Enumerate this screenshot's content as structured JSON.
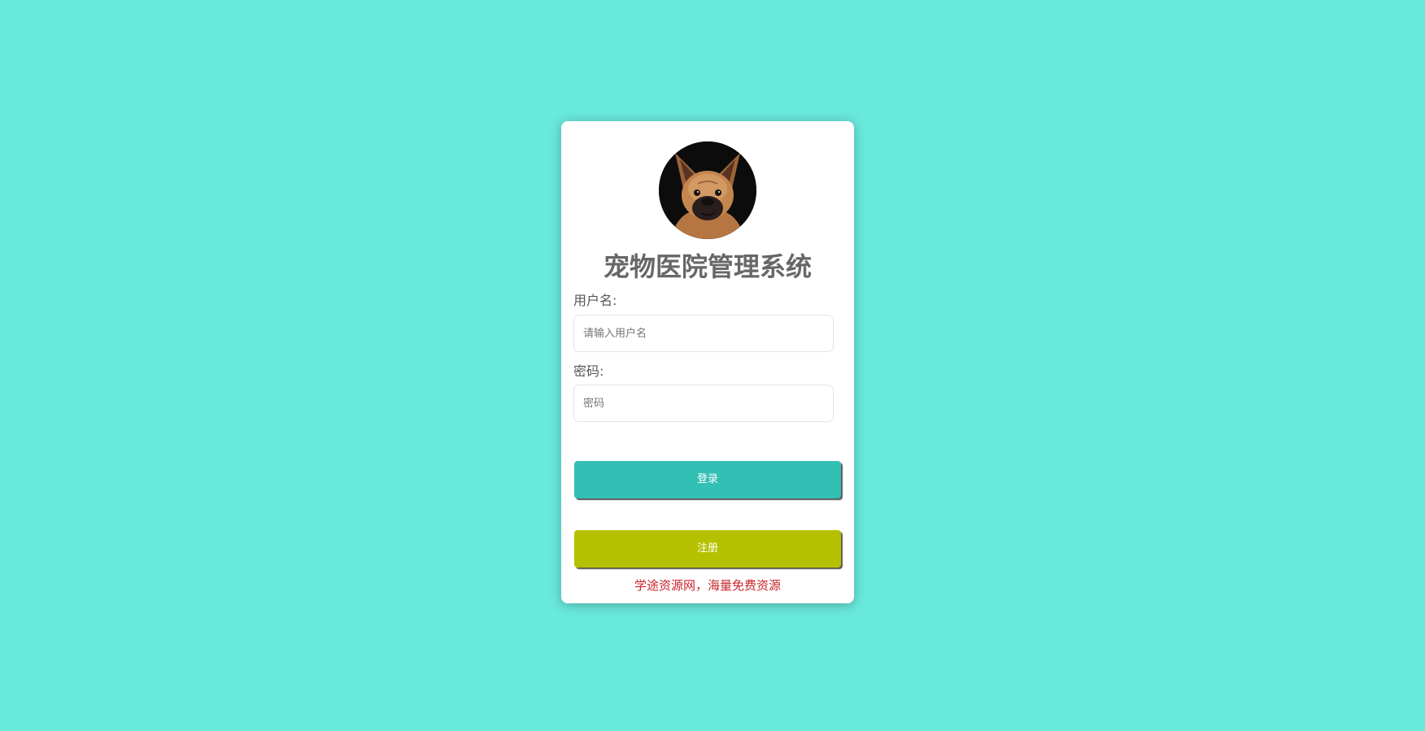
{
  "page": {
    "background_color": "#69e8dc"
  },
  "login_card": {
    "avatar": {
      "icon": "french-bulldog-photo"
    },
    "title": "宠物医院管理系统",
    "username_label": "用户名:",
    "username_placeholder": "请输入用户名",
    "password_label": "密码:",
    "password_placeholder": "密码",
    "login_button": {
      "label": "登录",
      "color": "#32bfb4"
    },
    "register_button": {
      "label": "注册",
      "color": "#b5c100"
    },
    "footer_note": {
      "text": "学途资源网，海量免费资源",
      "color": "#c8252a"
    }
  }
}
